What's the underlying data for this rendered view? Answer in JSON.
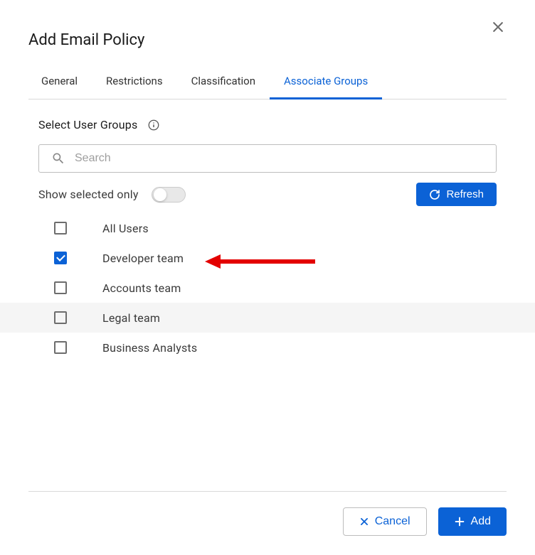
{
  "title": "Add Email Policy",
  "tabs": {
    "general": "General",
    "restrictions": "Restrictions",
    "classification": "Classification",
    "associate_groups": "Associate Groups",
    "active": "associate_groups"
  },
  "section": {
    "label": "Select User Groups"
  },
  "search": {
    "placeholder": "Search"
  },
  "controls": {
    "show_selected_label": "Show selected only",
    "show_selected_state": false,
    "refresh_label": "Refresh"
  },
  "groups": [
    {
      "label": "All Users",
      "checked": false,
      "highlighted": false
    },
    {
      "label": "Developer team",
      "checked": true,
      "highlighted": false
    },
    {
      "label": "Accounts team",
      "checked": false,
      "highlighted": false
    },
    {
      "label": "Legal team",
      "checked": false,
      "highlighted": true
    },
    {
      "label": "Business Analysts",
      "checked": false,
      "highlighted": false
    }
  ],
  "footer": {
    "cancel_label": "Cancel",
    "add_label": "Add"
  }
}
